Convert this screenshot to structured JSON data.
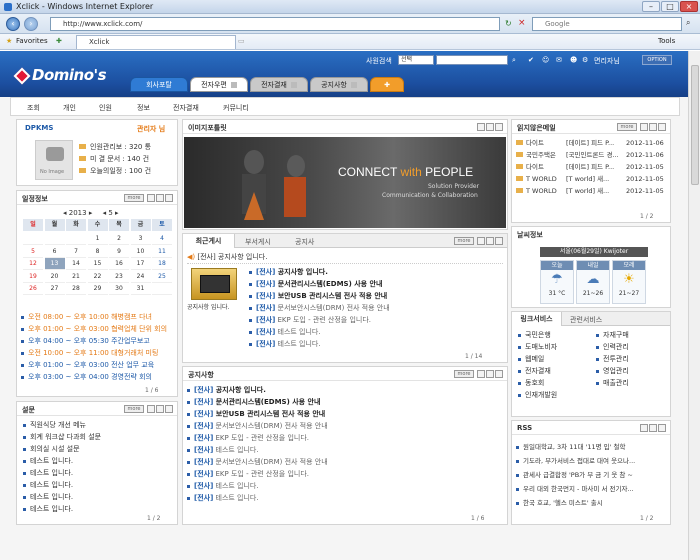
{
  "ie": {
    "window_title": "Xclick - Windows Internet Explorer",
    "address": "http://www.xclick.com/",
    "search_placeholder": "Google",
    "favorites_label": "Favorites",
    "tab_title": "Xclick",
    "tools_label": "Tools"
  },
  "header": {
    "logo": "Domino's",
    "search_label": "사원검색",
    "search_select": "선택",
    "user_links": "면리자님",
    "option_btn": "OPTION"
  },
  "main_tabs": [
    {
      "label": "회사포탈"
    },
    {
      "label": "전자우편"
    },
    {
      "label": "전자결재"
    },
    {
      "label": "공지사항"
    }
  ],
  "subnav": [
    "조회",
    "개인",
    "인원",
    "정보",
    "전자결재",
    "커뮤니티"
  ],
  "profile": {
    "title": "DPKMS",
    "role": "관리자 님",
    "no_image": "No Image",
    "stats": [
      {
        "label": "인원관리보 : 320 통"
      },
      {
        "label": "미 결 문서 : 140 건"
      },
      {
        "label": "오늘의일정 : 100 건"
      }
    ]
  },
  "schedule": {
    "title": "일정정보",
    "year": "2013",
    "month": "5",
    "weekdays": [
      "일",
      "월",
      "화",
      "수",
      "목",
      "금",
      "토"
    ],
    "weeks": [
      [
        "",
        "",
        "",
        "1",
        "2",
        "3",
        "4"
      ],
      [
        "5",
        "6",
        "7",
        "8",
        "9",
        "10",
        "11"
      ],
      [
        "12",
        "13",
        "14",
        "15",
        "16",
        "17",
        "18"
      ],
      [
        "19",
        "20",
        "21",
        "22",
        "23",
        "24",
        "25"
      ],
      [
        "26",
        "27",
        "28",
        "29",
        "30",
        "31",
        ""
      ]
    ],
    "events": [
      {
        "text": "오전 08:00 ~ 오후 10:00 해병캠프 다녀",
        "color": "#e47a16"
      },
      {
        "text": "오후 01:00 ~ 오후 03:00 협력업체 단위 회의",
        "color": "#e47a16"
      },
      {
        "text": "오후 04:00 ~ 오후 05:30 주간업무보고",
        "color": "#1e5aa8"
      },
      {
        "text": "오전 10:00 ~ 오후 11:00 대형거래처 미팅",
        "color": "#e47a16"
      },
      {
        "text": "오후 01:00 ~ 오후 03:00 전산 업무 교육",
        "color": "#1e5aa8"
      },
      {
        "text": "오후 03:00 ~ 오후 04:00 경영전략 회의",
        "color": "#1e5aa8"
      }
    ],
    "pager": "1 / 6"
  },
  "survey": {
    "title": "설문",
    "items": [
      "직원식당 개선 메뉴",
      "회계 워크샵 다과회 설문",
      "회의실 시설 설문",
      "테스트 입니다.",
      "테스트 입니다.",
      "테스트 입니다.",
      "테스트 입니다.",
      "테스트 입니다."
    ],
    "pager": "1 / 2"
  },
  "image_board": {
    "title": "이미지포틀릿",
    "banner_main": "CONNECT",
    "banner_with": "with",
    "banner_people": "PEOPLE",
    "banner_sub1": "Solution Provider",
    "banner_sub2": "Communication & Collaboration"
  },
  "recent_board": {
    "tabs": [
      "최근게시",
      "부서게시",
      "공지사"
    ],
    "top_line": "[전사] 공지사항 입니다.",
    "thumb_caption": "공지사항 입니다.",
    "items": [
      {
        "tag": "[전사]",
        "text": "공지사항 입니다.",
        "strong": true
      },
      {
        "tag": "[전사]",
        "text": "문서관리시스템(EDMS) 사용 안내",
        "strong": true
      },
      {
        "tag": "[전사]",
        "text": "보안USB 관리시스템 전사 적용 안내",
        "strong": true
      },
      {
        "tag": "[전사]",
        "text": "문서보안시스템(DRM) 전사 적용 안내",
        "strong": false
      },
      {
        "tag": "[전사]",
        "text": "EKP 도입 - 관련 산정을 입니다.",
        "strong": false
      },
      {
        "tag": "[전사]",
        "text": "테스트 입니다.",
        "strong": false
      },
      {
        "tag": "[전사]",
        "text": "테스트 입니다.",
        "strong": false
      }
    ],
    "pager": "1 / 14"
  },
  "notice": {
    "title": "공지사항",
    "items": [
      {
        "tag": "[전사]",
        "text": "공지사항 입니다.",
        "strong": true
      },
      {
        "tag": "[전사]",
        "text": "문서관리시스템(EDMS) 사용 안내",
        "strong": true
      },
      {
        "tag": "[전사]",
        "text": "보안USB 관리시스템 전사 적용 안내",
        "strong": true
      },
      {
        "tag": "[전사]",
        "text": "문서보안시스템(DRM) 전사 적용 안내",
        "strong": false
      },
      {
        "tag": "[전사]",
        "text": "EKP 도입 - 관련 산정을 입니다.",
        "strong": false
      },
      {
        "tag": "[전사]",
        "text": "테스트 입니다.",
        "strong": false
      },
      {
        "tag": "[전사]",
        "text": "문서보안시스템(DRM) 전사 적용 안내",
        "strong": false
      },
      {
        "tag": "[전사]",
        "text": "EKP 도입 - 관련 산정을 입니다.",
        "strong": false
      },
      {
        "tag": "[전사]",
        "text": "테스트 입니다.",
        "strong": false
      },
      {
        "tag": "[전사]",
        "text": "테스트 입니다.",
        "strong": false
      }
    ],
    "pager": "1 / 6"
  },
  "mail": {
    "title": "읽지않은메일",
    "items": [
      {
        "from": "다이트",
        "subject": "[데이트] 피드 P...",
        "date": "2012-11-06"
      },
      {
        "from": "국민주택은",
        "subject": "[국민인트론드 경...",
        "date": "2012-11-06"
      },
      {
        "from": "다이트",
        "subject": "[데이트] 피드 P...",
        "date": "2012-11-05"
      },
      {
        "from": "T WORLD",
        "subject": "[T world] 새...",
        "date": "2012-11-05"
      },
      {
        "from": "T WORLD",
        "subject": "[T world] 새...",
        "date": "2012-11-05"
      }
    ],
    "pager": "1 / 2"
  },
  "weather": {
    "title": "날씨정보",
    "location": "서울(06월29일)",
    "today": "Kwijoter",
    "days": [
      {
        "label": "오늘",
        "temp": "31 °C"
      },
      {
        "label": "내일",
        "temp": "21~26"
      },
      {
        "label": "모레",
        "temp": "21~27"
      }
    ]
  },
  "links": {
    "tabs": [
      "링크서비스",
      "관련서비스"
    ],
    "left": [
      "국민은행",
      "도매노비자",
      "웹메일",
      "전자결재",
      "동호회",
      "인재개발원"
    ],
    "right": [
      "자재구매",
      "인력관리",
      "전투관리",
      "영업관리",
      "매출관리"
    ]
  },
  "rss": {
    "title": "RSS",
    "items": [
      "원일대학교, 3차 11대 '11명 입' 철학",
      "기도라, 부가서비스 접대로 대여 웃으나...",
      "관세사 급결합정 'PB가 부 금 기 웃 참 ~",
      "우리 대외 한국먼지 - 마사미 서 전기자...",
      "한국 호교, '헬스 미스트' 출시"
    ],
    "pager": "1 / 2"
  }
}
